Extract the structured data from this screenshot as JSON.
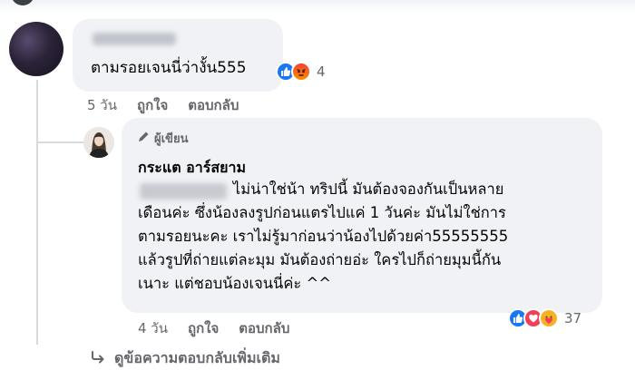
{
  "comment1": {
    "text": "ตามรอยเจนนี่ว่างั้น555",
    "reactions": {
      "icons": [
        "like-icon",
        "angry-icon"
      ],
      "count": "4"
    },
    "meta": {
      "time": "5 วัน",
      "like": "ถูกใจ",
      "reply": "ตอบกลับ"
    }
  },
  "reply": {
    "author_badge": "ผู้เขียน",
    "author_name": "กระแต อาร์สยาม",
    "body": "                    ไม่น่าใช่น้า ทริปนี้ มันต้องจองกันเป็นหลาย\nเดือนค่ะ ซึ่งน้องลงรูปก่อนแตรไปแค่ 1 วันค่ะ มันไม่ใช่การ\nตามรอยนะคะ เราไม่รู้มาก่อนว่าน้องไปด้วยค่า55555555\nแล้วรูปที่ถ่ายแต่ละมุม มันต้องถ่ายอ่ะ ใครไปก็ถ่ายมุมนี้กัน\nเนาะ แต่ชอบน้องเจนนี่ค่ะ ^^",
    "reactions": {
      "icons": [
        "like-icon",
        "love-icon",
        "care-icon"
      ],
      "count": "37"
    },
    "meta": {
      "time": "4 วัน",
      "like": "ถูกใจ",
      "reply": "ตอบกลับ"
    }
  },
  "more_replies": {
    "label": "ดูข้อความตอบกลับเพิ่มเติม"
  },
  "colors": {
    "like": "#1877f2",
    "love": "#f33e58",
    "angry": "#f44336",
    "care": "#f7b125",
    "bubble": "#f0f2f5",
    "muted": "#65676b"
  }
}
